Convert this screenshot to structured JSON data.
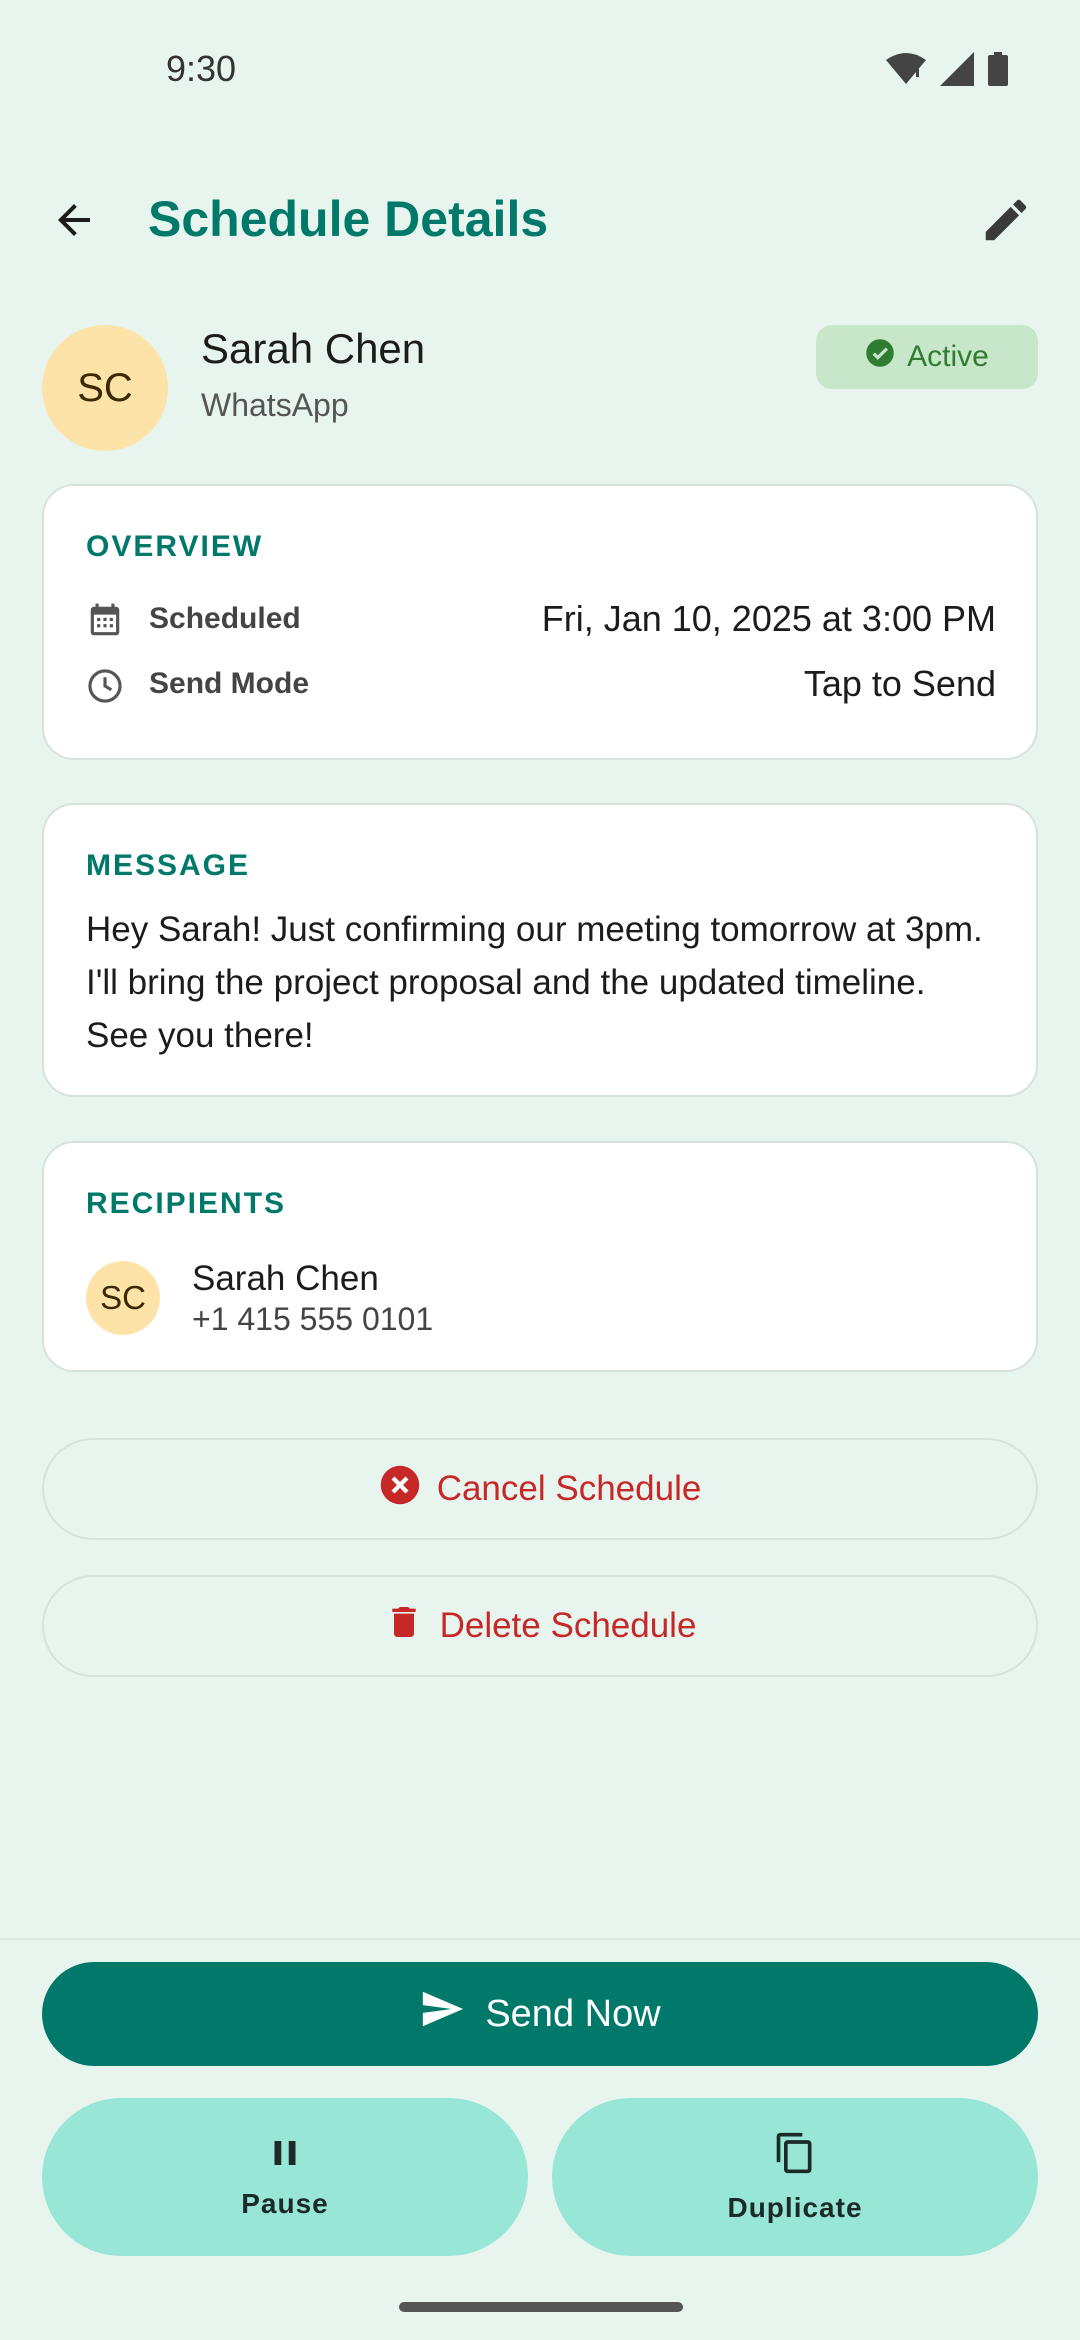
{
  "status_bar": {
    "time": "9:30"
  },
  "app_bar": {
    "title": "Schedule Details"
  },
  "contact": {
    "initials": "SC",
    "name": "Sarah Chen",
    "app": "WhatsApp",
    "status": "Active"
  },
  "overview": {
    "title": "OVERVIEW",
    "rows": [
      {
        "label": "Scheduled",
        "value": "Fri, Jan 10, 2025 at 3:00 PM",
        "icon": "calendar-icon"
      },
      {
        "label": "Send Mode",
        "value": "Tap to Send",
        "icon": "clock-icon"
      }
    ]
  },
  "message": {
    "title": "MESSAGE",
    "text": "Hey Sarah! Just confirming our meeting tomorrow at 3pm. I'll bring the project proposal and the updated timeline. See you there!"
  },
  "recipients": {
    "title": "RECIPIENTS",
    "items": [
      {
        "initials": "SC",
        "name": "Sarah Chen",
        "phone": "+1 415 555 0101"
      }
    ]
  },
  "actions": {
    "cancel_label": "Cancel Schedule",
    "delete_label": "Delete Schedule",
    "send_now_label": "Send Now",
    "pause_label": "Pause",
    "duplicate_label": "Duplicate"
  },
  "colors": {
    "background": "#e8f5ee",
    "primary": "#00796b",
    "danger": "#c62828",
    "tonal": "#98e6d6",
    "badge_bg": "#c8e6c9",
    "badge_fg": "#2e7d32"
  }
}
